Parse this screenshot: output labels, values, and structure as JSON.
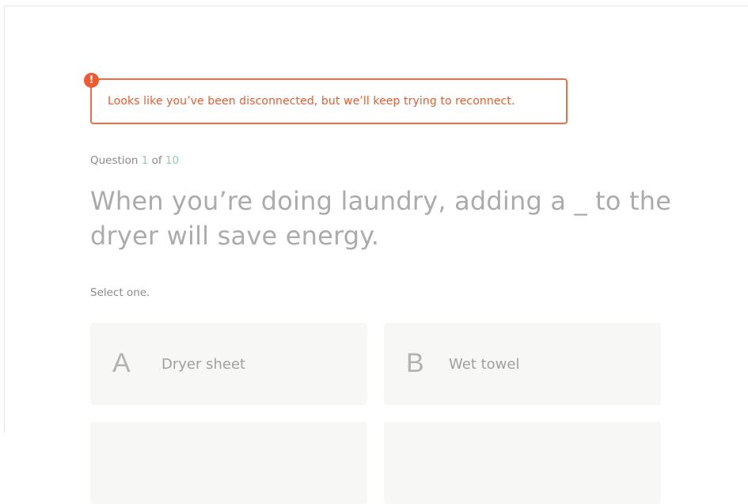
{
  "alert": {
    "icon": "exclamation-icon",
    "message": "Looks like you’ve been disconnected, but we’ll keep trying to reconnect.",
    "color": "#ef5a2e"
  },
  "progress": {
    "prefix": "Question",
    "current": "1",
    "separator": "of",
    "total": "10",
    "number_color": "#8fd3a6"
  },
  "question": {
    "text": "When you’re doing laundry, adding a _ to the dryer will save energy."
  },
  "instruction": "Select one.",
  "options": [
    {
      "letter": "A",
      "label": "Dryer sheet"
    },
    {
      "letter": "B",
      "label": "Wet towel"
    }
  ]
}
